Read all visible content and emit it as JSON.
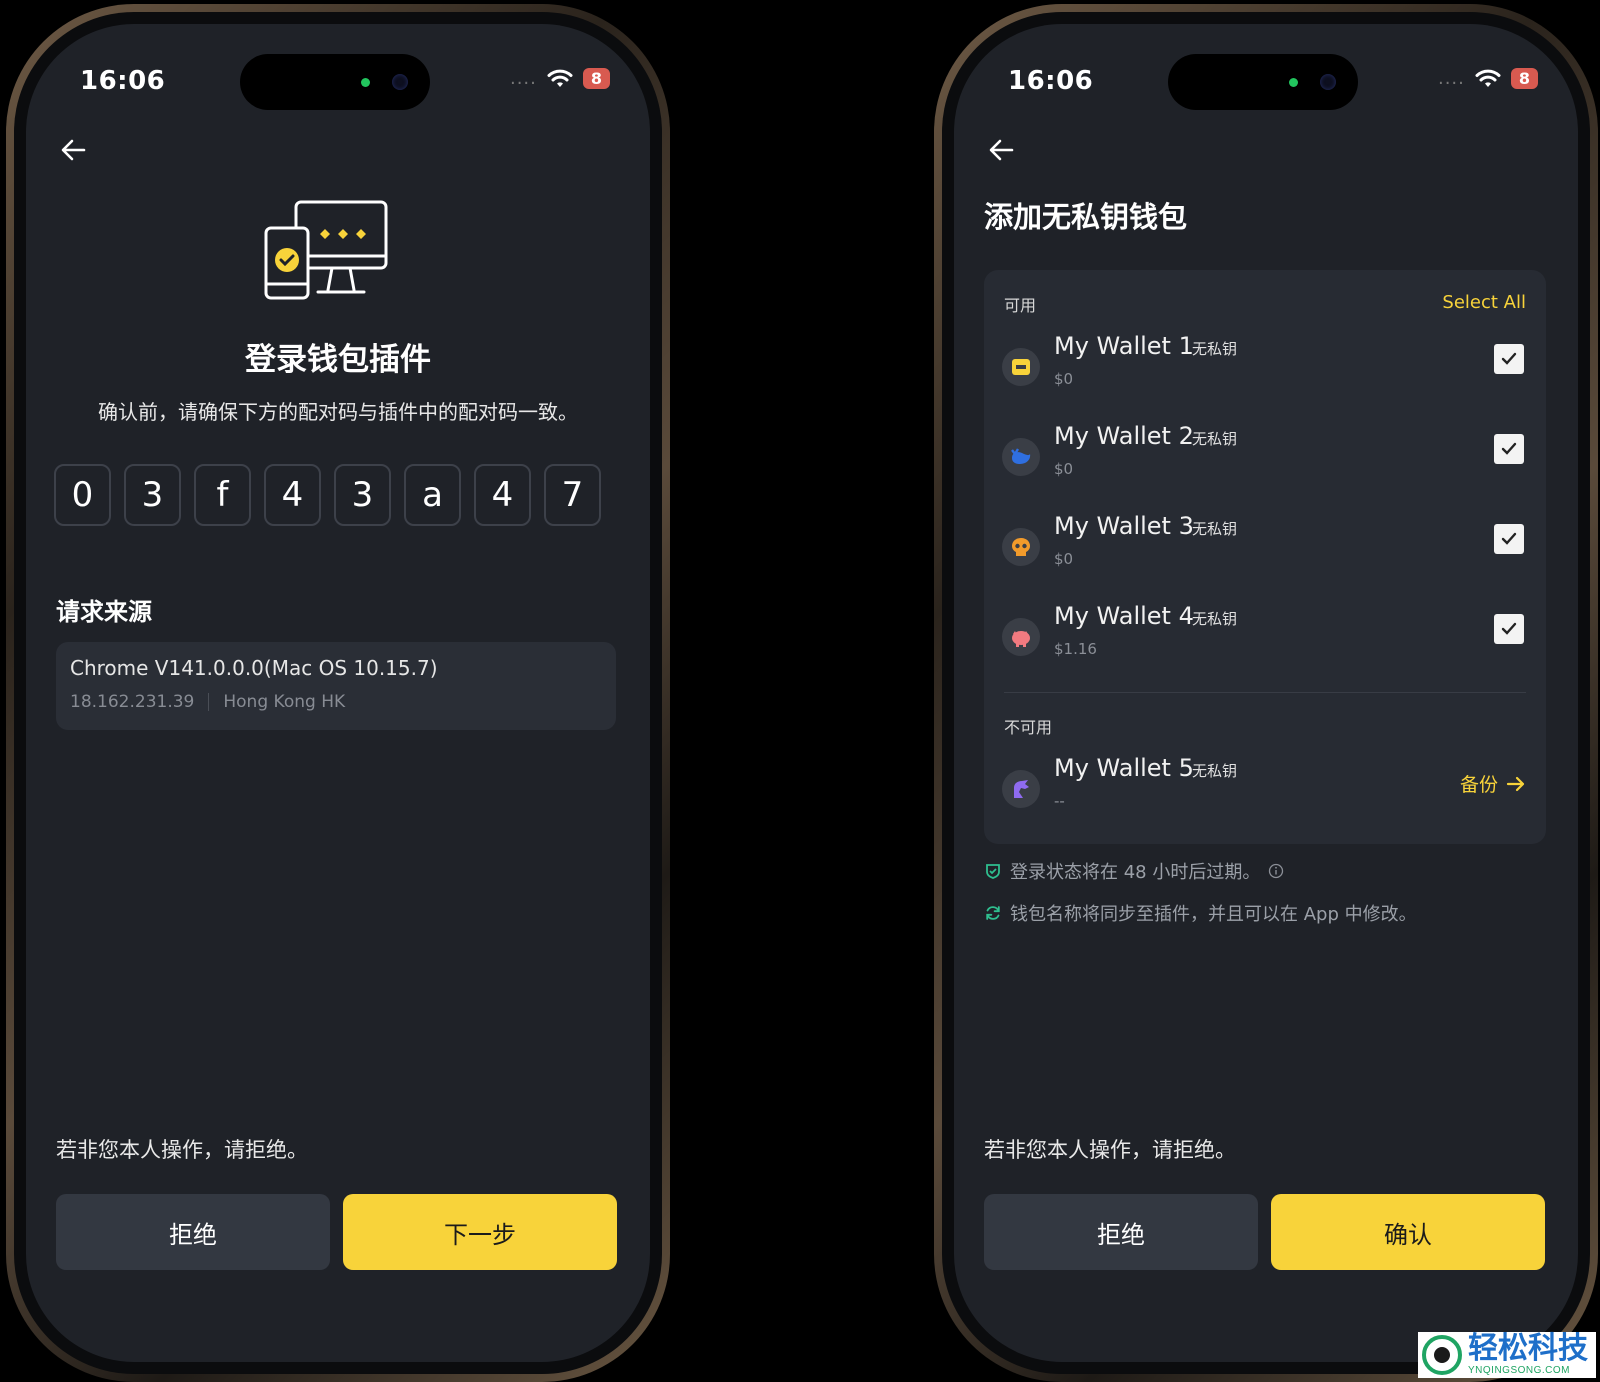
{
  "status_bar": {
    "time": "16:06",
    "signal": "....",
    "battery": "8"
  },
  "left": {
    "title": "登录钱包插件",
    "subtitle": "确认前，请确保下方的配对码与插件中的配对码一致。",
    "code": [
      "0",
      "3",
      "f",
      "4",
      "3",
      "a",
      "4",
      "7"
    ],
    "source_heading": "请求来源",
    "source": {
      "name": "Chrome V141.0.0.0(Mac OS 10.15.7)",
      "ip": "18.162.231.39",
      "location": "Hong Kong HK"
    },
    "warning": "若非您本人操作，请拒绝。",
    "reject_label": "拒绝",
    "next_label": "下一步"
  },
  "right": {
    "title": "添加无私钥钱包",
    "available_label": "可用",
    "select_all": "Select All",
    "wallets": [
      {
        "name": "My Wallet 1",
        "tag": "无私钥",
        "balance": "$0",
        "checked": true,
        "icon": "wallet-yellow-icon"
      },
      {
        "name": "My Wallet 2",
        "tag": "无私钥",
        "balance": "$0",
        "checked": true,
        "icon": "whale-blue-icon"
      },
      {
        "name": "My Wallet 3",
        "tag": "无私钥",
        "balance": "$0",
        "checked": true,
        "icon": "skull-orange-icon"
      },
      {
        "name": "My Wallet 4",
        "tag": "无私钥",
        "balance": "$1.16",
        "checked": true,
        "icon": "pig-pink-icon"
      }
    ],
    "unavailable_label": "不可用",
    "unavailable_wallet": {
      "name": "My Wallet 5",
      "tag": "无私钥",
      "balance": "--",
      "action": "备份",
      "icon": "unicorn-purple-icon"
    },
    "note_expiry": "登录状态将在 48 小时后过期。",
    "note_sync": "钱包名称将同步至插件，并且可以在 App 中修改。",
    "warning": "若非您本人操作，请拒绝。",
    "reject_label": "拒绝",
    "confirm_label": "确认"
  },
  "watermark": {
    "cn": "轻松科技",
    "en": "YNQINGSONG.COM"
  },
  "colors": {
    "accent": "#f8d33a",
    "screen_bg": "#1f2228",
    "card_bg": "#272b33",
    "note_icon": "#2fbf8f"
  }
}
